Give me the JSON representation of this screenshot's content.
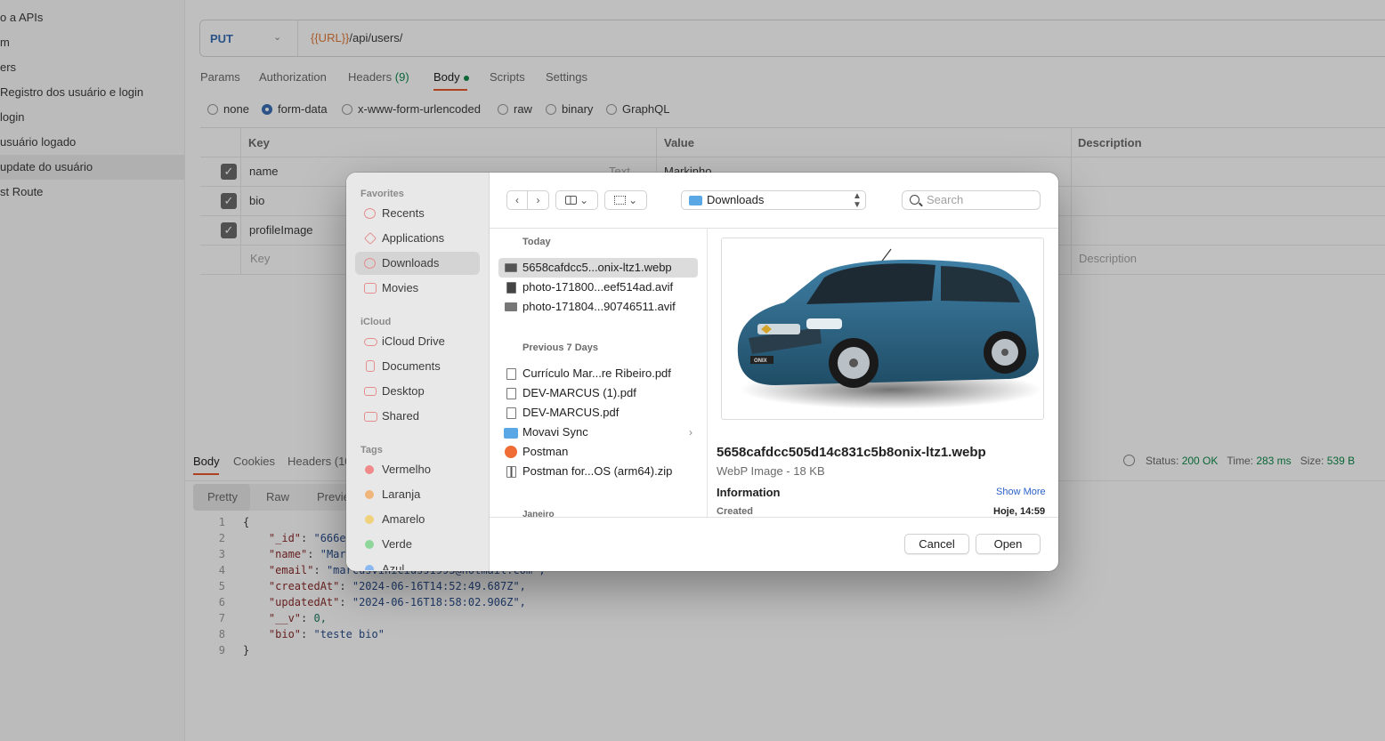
{
  "sidebar": {
    "items": [
      {
        "label": "o a APIs"
      },
      {
        "label": "m"
      },
      {
        "label": "ers"
      },
      {
        "label": "Registro dos usuário e login"
      },
      {
        "label": "login"
      },
      {
        "label": "usuário logado"
      },
      {
        "label": "update do usuário"
      },
      {
        "label": "st Route"
      }
    ]
  },
  "request": {
    "method": "PUT",
    "url_var": "{{URL}}",
    "url_path": "/api/users/",
    "tabs": {
      "params": "Params",
      "authorization": "Authorization",
      "headers": "Headers",
      "headers_count": "(9)",
      "body": "Body",
      "scripts": "Scripts",
      "settings": "Settings"
    },
    "body_types": [
      "none",
      "form-data",
      "x-www-form-urlencoded",
      "raw",
      "binary",
      "GraphQL"
    ],
    "body_type_selected": "form-data",
    "table_headers": {
      "key": "Key",
      "value": "Value",
      "description": "Description"
    },
    "rows": [
      {
        "key": "name",
        "type": "Text",
        "value": "Markinho"
      },
      {
        "key": "bio"
      },
      {
        "key": "profileImage"
      }
    ],
    "placeholder_key": "Key",
    "placeholder_description": "Description"
  },
  "response": {
    "tabs": {
      "body": "Body",
      "cookies": "Cookies",
      "headers": "Headers (10"
    },
    "status_label": "Status:",
    "status_value": "200 OK",
    "time_label": "Time:",
    "time_value": "283 ms",
    "size_label": "Size:",
    "size_value": "539 B",
    "view_tabs": {
      "pretty": "Pretty",
      "raw": "Raw",
      "preview": "Previe"
    },
    "code": [
      {
        "n": "1",
        "text": "{"
      },
      {
        "n": "2",
        "k": "\"_id\"",
        "v": "\"666e",
        "t": "str"
      },
      {
        "n": "3",
        "k": "\"name\"",
        "v": "\"Mar",
        "t": "str"
      },
      {
        "n": "4",
        "k": "\"email\"",
        "v": "\"marcusviniciuss1993@hotmail.com\",",
        "t": "str"
      },
      {
        "n": "5",
        "k": "\"createdAt\"",
        "v": "\"2024-06-16T14:52:49.687Z\",",
        "t": "str"
      },
      {
        "n": "6",
        "k": "\"updatedAt\"",
        "v": "\"2024-06-16T18:58:02.906Z\",",
        "t": "str"
      },
      {
        "n": "7",
        "k": "\"__v\"",
        "v": "0,",
        "t": "num"
      },
      {
        "n": "8",
        "k": "\"bio\"",
        "v": "\"teste bio\"",
        "t": "str"
      },
      {
        "n": "9",
        "text": "}"
      }
    ]
  },
  "dialog": {
    "sidebar": {
      "favorites_title": "Favorites",
      "favorites": [
        "Recents",
        "Applications",
        "Downloads",
        "Movies"
      ],
      "selected": "Downloads",
      "icloud_title": "iCloud",
      "icloud": [
        "iCloud Drive",
        "Documents",
        "Desktop",
        "Shared"
      ],
      "tags_title": "Tags",
      "tags": [
        {
          "label": "Vermelho",
          "color": "#f08a8a"
        },
        {
          "label": "Laranja",
          "color": "#f0b57a"
        },
        {
          "label": "Amarelo",
          "color": "#f0d27a"
        },
        {
          "label": "Verde",
          "color": "#8fd69b"
        },
        {
          "label": "Azul",
          "color": "#8ab8f0"
        }
      ]
    },
    "toolbar": {
      "back_icon": "‹",
      "forward_icon": "›",
      "location": "Downloads",
      "search_placeholder": "Search"
    },
    "groups": [
      {
        "title": "Today",
        "files": [
          {
            "name": "5658cafdcc5...onix-ltz1.webp",
            "icon": "image"
          },
          {
            "name": "photo-171800...eef514ad.avif",
            "icon": "image"
          },
          {
            "name": "photo-171804...90746511.avif",
            "icon": "image"
          }
        ]
      },
      {
        "title": "Previous 7 Days",
        "files": [
          {
            "name": "Currículo Mar...re Ribeiro.pdf",
            "icon": "pdf"
          },
          {
            "name": "DEV-MARCUS (1).pdf",
            "icon": "pdf"
          },
          {
            "name": "DEV-MARCUS.pdf",
            "icon": "pdf"
          },
          {
            "name": "Movavi Sync",
            "icon": "folder"
          },
          {
            "name": "Postman",
            "icon": "app"
          },
          {
            "name": "Postman for...OS (arm64).zip",
            "icon": "zip"
          }
        ]
      },
      {
        "title": "Janeiro"
      }
    ],
    "preview": {
      "file_name": "5658cafdcc505d14c831c5b8onix-ltz1.webp",
      "kind": "WebP Image - 18 KB",
      "info_title": "Information",
      "show_more": "Show More",
      "created_label": "Created",
      "created_value": "Hoje, 14:59",
      "badge": "ONIX"
    },
    "buttons": {
      "cancel": "Cancel",
      "open": "Open"
    }
  },
  "colors": {
    "accent": "#e8572a",
    "success": "#0f8a4a",
    "method": "#3a6fb5",
    "body_color": "#2e5d79"
  }
}
